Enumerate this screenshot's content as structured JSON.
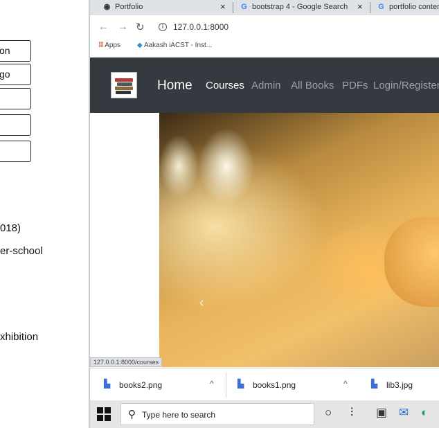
{
  "left_pane": {
    "boxes": [
      "on",
      "go",
      "",
      "",
      ""
    ],
    "texts": [
      "018)",
      "er-school",
      "xhibition"
    ]
  },
  "browser": {
    "tabs": [
      {
        "icon": "github-icon",
        "glyph": "◉",
        "title": "Portfolio"
      },
      {
        "icon": "google-icon",
        "glyph": "G",
        "title": "bootstrap 4 - Google Search"
      },
      {
        "icon": "google-icon",
        "glyph": "G",
        "title": "portfolio content"
      }
    ],
    "tab_close_glyph": "×",
    "url": "127.0.0.1:8000",
    "bookmarks": [
      {
        "icon": "apps-icon",
        "label": "Apps"
      },
      {
        "icon": "aakash-icon",
        "label": "Aakash iACST - Inst..."
      }
    ]
  },
  "site": {
    "brand": "Home",
    "nav_links": [
      {
        "label": "Courses",
        "color": "#ffffff"
      },
      {
        "label": "Admin",
        "color": "#9aa0a6"
      },
      {
        "label": "All Books",
        "color": "#9aa0a6"
      },
      {
        "label": "PDFs",
        "color": "#9aa0a6"
      },
      {
        "label": "Login/Register",
        "color": "#9aa0a6"
      }
    ],
    "carousel_prev_glyph": "‹"
  },
  "status_url": "127.0.0.1:8000/courses",
  "downloads": [
    {
      "name": "books2.png",
      "chevron": "^"
    },
    {
      "name": "books1.png",
      "chevron": "^"
    },
    {
      "name": "lib3.jpg",
      "chevron": ""
    }
  ],
  "taskbar": {
    "search_placeholder": "Type here to search",
    "icons": [
      "cortana-icon",
      "task-view-icon",
      "store-icon",
      "mail-icon",
      "edge-icon"
    ]
  }
}
